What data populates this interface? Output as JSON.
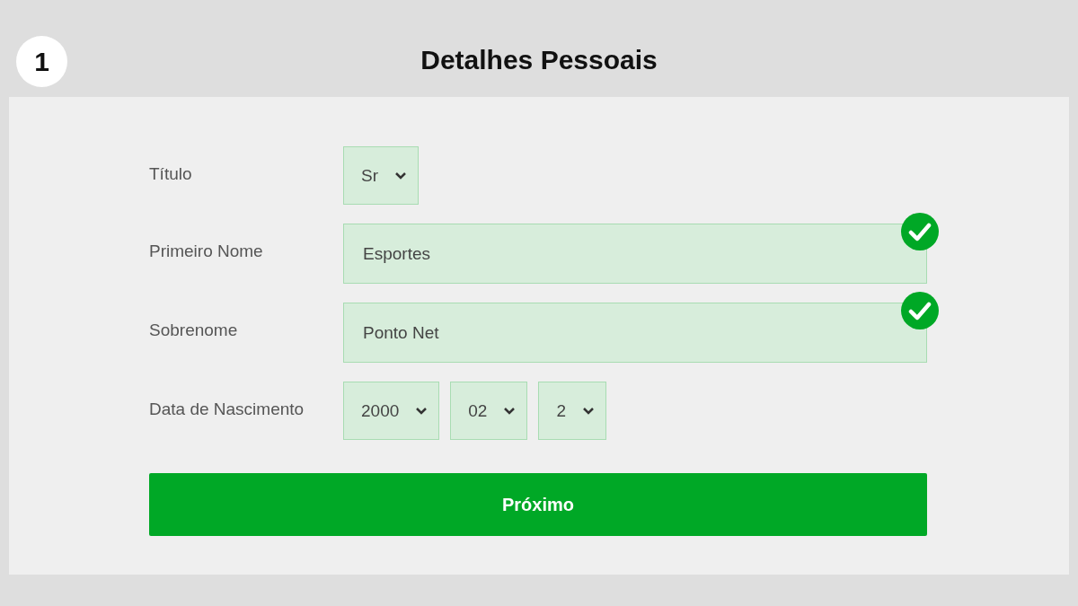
{
  "step": {
    "number": "1",
    "title": "Detalhes Pessoais"
  },
  "fields": [
    {
      "kind": "select",
      "label": "Título",
      "selects": [
        {
          "value": "Sr"
        }
      ]
    },
    {
      "kind": "text",
      "label": "Primeiro Nome",
      "value": "Esportes",
      "valid": true
    },
    {
      "kind": "text",
      "label": "Sobrenome",
      "value": "Ponto Net",
      "valid": true
    },
    {
      "kind": "select",
      "label": "Data de Nascimento",
      "selects": [
        {
          "value": "2000"
        },
        {
          "value": "02"
        },
        {
          "value": "2"
        }
      ]
    }
  ],
  "button": "Próximo"
}
